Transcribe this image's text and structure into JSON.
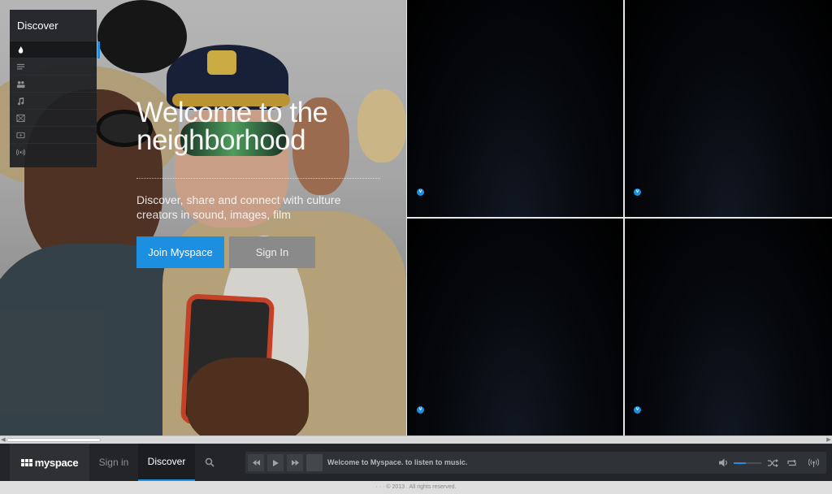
{
  "hero": {
    "welcome_title": "Welcome to the neighborhood",
    "tagline": "Discover, share and connect with culture creators in sound, images, film",
    "join_label": "Join Myspace",
    "signin_label": "Sign In"
  },
  "sidebar": {
    "title": "Discover",
    "items": [
      {
        "icon": "flame-icon",
        "active": true
      },
      {
        "icon": "list-icon",
        "active": false
      },
      {
        "icon": "people-icon",
        "active": false
      },
      {
        "icon": "music-note-icon",
        "active": false
      },
      {
        "icon": "image-icon",
        "active": false
      },
      {
        "icon": "video-icon",
        "active": false
      },
      {
        "icon": "radio-icon",
        "active": false
      }
    ]
  },
  "video_tiles": [
    {
      "badge": "v"
    },
    {
      "badge": "v"
    },
    {
      "badge": "v"
    },
    {
      "badge": "v"
    }
  ],
  "bottombar": {
    "logo_text": "myspace",
    "nav_signin": "Sign in",
    "nav_discover": "Discover",
    "player_message": "Welcome to Myspace. to listen to music.",
    "volume_level": 0.45
  },
  "footer": {
    "copyright": "· · · © 2013 . All rights reserved."
  },
  "colors": {
    "accent": "#1d8fe1",
    "bar_bg": "#232529",
    "signin_button": "#8a8a8a"
  }
}
